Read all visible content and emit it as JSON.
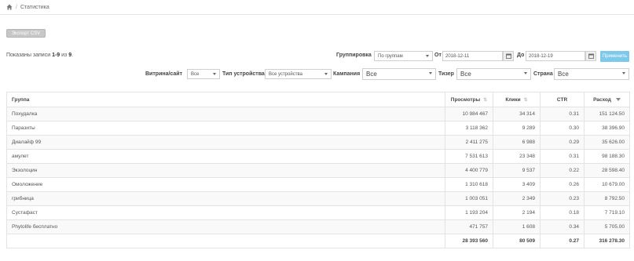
{
  "breadcrumb": {
    "home_icon": "home-icon",
    "current": "Статистика"
  },
  "toolbar": {
    "export_label": "Экспорт CSV"
  },
  "records_info": {
    "prefix": "Показаны записи ",
    "range": "1-9",
    "middle": " из ",
    "total": "9",
    "suffix": "."
  },
  "filters": {
    "grouping_label": "Группировка",
    "grouping_value": "По группам",
    "from_label": "От",
    "from_value": "2018-12-11",
    "to_label": "До",
    "to_value": "2018-12-19",
    "apply_label": "Применить",
    "showcase_label": "Витрина/сайт",
    "showcase_value": "Все",
    "device_label": "Тип устройства",
    "device_value": "Все устройства",
    "campaign_label": "Кампания",
    "campaign_value": "Все",
    "teaser_label": "Тизер",
    "teaser_value": "Все",
    "country_label": "Страна",
    "country_value": "Все"
  },
  "table": {
    "headers": {
      "group": "Группа",
      "views": "Просмотры",
      "clicks": "Клики",
      "ctr": "CTR",
      "spend": "Расход"
    },
    "rows": [
      {
        "group": "Похудалка",
        "views": "10 984 467",
        "clicks": "34 314",
        "ctr": "0.31",
        "spend": "151 124.50"
      },
      {
        "group": "Паразиты",
        "views": "3 118 362",
        "clicks": "9 289",
        "ctr": "0.30",
        "spend": "38 396.90"
      },
      {
        "group": "Диалайф 99",
        "views": "2 411 275",
        "clicks": "6 988",
        "ctr": "0.29",
        "spend": "35 626.00"
      },
      {
        "group": "амулет",
        "views": "7 531 613",
        "clicks": "23 348",
        "ctr": "0.31",
        "spend": "98 188.30"
      },
      {
        "group": "Экзолоцин",
        "views": "4 400 779",
        "clicks": "9 537",
        "ctr": "0.22",
        "spend": "28 598.40"
      },
      {
        "group": "Омоложение",
        "views": "1 310 618",
        "clicks": "3 409",
        "ctr": "0.26",
        "spend": "10 679.00"
      },
      {
        "group": "грибница",
        "views": "1 003 051",
        "clicks": "2 349",
        "ctr": "0.23",
        "spend": "8 792.50"
      },
      {
        "group": "Сустафаст",
        "views": "1 193 204",
        "clicks": "2 194",
        "ctr": "0.18",
        "spend": "7 719.10"
      },
      {
        "group": "Phytolife бесплатно",
        "views": "471 757",
        "clicks": "1 608",
        "ctr": "0.34",
        "spend": "5 705.00"
      }
    ],
    "totals": {
      "views": "28 393 560",
      "clicks": "80 509",
      "ctr": "0.27",
      "spend": "316 278.30"
    }
  }
}
